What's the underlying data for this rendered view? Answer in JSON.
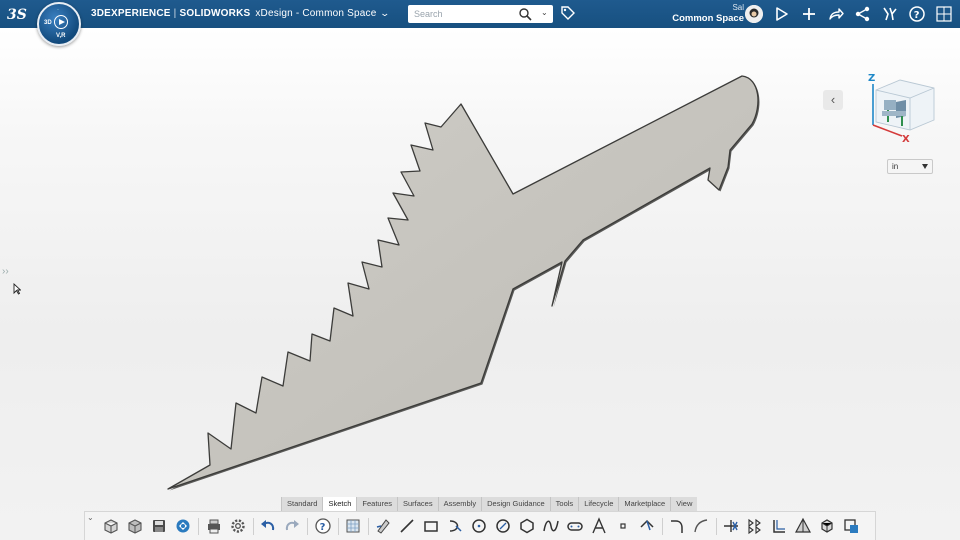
{
  "topbar": {
    "brand_3d": "3DEXPERIENCE",
    "brand_sw": "SOLIDWORKS",
    "app_title": "xDesign - Common Space",
    "compass_left": "3D",
    "compass_bottom": "V,R",
    "search_placeholder": "Search",
    "user_name": "Sal",
    "space_name": "Common Space",
    "icons": [
      "ds-logo-icon",
      "compass-icon",
      "chevron-down-icon",
      "search-icon",
      "tag-icon",
      "avatar",
      "share-flag-icon",
      "add-icon",
      "forward-icon",
      "share-icon",
      "apps-icon",
      "help-icon",
      "grid-icon"
    ]
  },
  "viewport": {
    "units": "in",
    "viewcube_axes": [
      "Z",
      "X"
    ],
    "part_color": "#c8c6c0"
  },
  "command_tabs": [
    "Standard",
    "Sketch",
    "Features",
    "Surfaces",
    "Assembly",
    "Design Guidance",
    "Tools",
    "Lifecycle",
    "Marketplace",
    "View"
  ],
  "active_tab": "Sketch",
  "toolbar": {
    "icons": [
      "new-part-icon",
      "open-icon",
      "save-icon",
      "save-as-icon",
      "print-icon",
      "settings-icon",
      "undo-icon",
      "redo-icon",
      "help-icon",
      "sketch-plane-icon",
      "pen-icon",
      "line-icon",
      "rectangle-icon",
      "arc-icon",
      "circle-icon",
      "ellipse-icon",
      "polygon-icon",
      "spline-icon",
      "slot-icon",
      "text-icon",
      "point-icon",
      "construction-icon",
      "fillet-icon",
      "chamfer-icon",
      "trim-icon",
      "offset-icon",
      "convert-icon",
      "mirror-icon",
      "pattern-icon",
      "extrude-icon"
    ]
  }
}
